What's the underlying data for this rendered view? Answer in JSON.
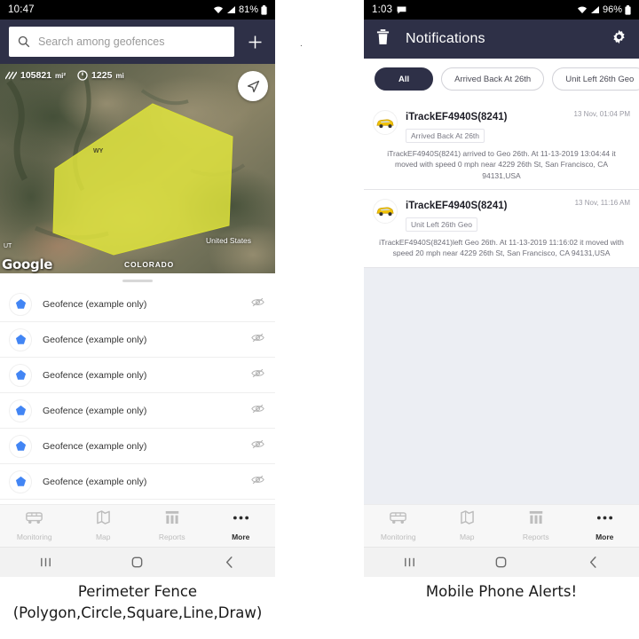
{
  "left_phone": {
    "status_bar": {
      "time": "10:47",
      "battery": "81%",
      "icons": [
        "wifi-icon",
        "signal-icon",
        "battery-icon"
      ]
    },
    "search": {
      "placeholder": "Search among geofences",
      "icon": "search-icon"
    },
    "add_button": {
      "label": "+",
      "icon": "plus-icon"
    },
    "map": {
      "area_value": "105821",
      "area_unit": "mi²",
      "perimeter_value": "1225",
      "perimeter_unit": "mi",
      "area_icon": "area-hatch-icon",
      "perimeter_icon": "perimeter-clock-icon",
      "locate_icon": "navigation-arrow-icon",
      "watermark": "Google",
      "labels": {
        "state": "COLORADO",
        "country": "United States",
        "wy": "WY",
        "ut": "UT"
      },
      "polygon_color": "#e3e83c"
    },
    "geofences": [
      {
        "name": "Geofence (example only)",
        "icon": "pentagon-icon",
        "visibility_icon": "eye-off-icon"
      },
      {
        "name": "Geofence (example only)",
        "icon": "pentagon-icon",
        "visibility_icon": "eye-off-icon"
      },
      {
        "name": "Geofence (example only)",
        "icon": "pentagon-icon",
        "visibility_icon": "eye-off-icon"
      },
      {
        "name": "Geofence (example only)",
        "icon": "pentagon-icon",
        "visibility_icon": "eye-off-icon"
      },
      {
        "name": "Geofence (example only)",
        "icon": "pentagon-icon",
        "visibility_icon": "eye-off-icon"
      },
      {
        "name": "Geofence (example only)",
        "icon": "pentagon-icon",
        "visibility_icon": "eye-off-icon"
      }
    ],
    "bottom_nav": [
      {
        "label": "Monitoring",
        "icon": "bus-icon",
        "active": false
      },
      {
        "label": "Map",
        "icon": "map-icon",
        "active": false
      },
      {
        "label": "Reports",
        "icon": "reports-icon",
        "active": false
      },
      {
        "label": "More",
        "icon": "more-dots-icon",
        "active": true
      }
    ]
  },
  "right_phone": {
    "status_bar": {
      "time": "1:03",
      "battery": "96%",
      "icons": [
        "message-icon",
        "wifi-icon",
        "signal-icon",
        "battery-icon"
      ]
    },
    "header": {
      "title": "Notifications",
      "delete_icon": "trash-icon",
      "settings_icon": "gear-icon"
    },
    "filters": [
      {
        "label": "All",
        "selected": true
      },
      {
        "label": "Arrived Back At 26th",
        "selected": false
      },
      {
        "label": "Unit Left 26th Geo",
        "selected": false
      }
    ],
    "notifications": [
      {
        "unit": "iTrackEF4940S(8241)",
        "tag": "Arrived Back At 26th",
        "time": "13 Nov, 01:04 PM",
        "body": "iTrackEF4940S(8241) arrived to Geo 26th.    At 11-13-2019 13:04:44 it moved with speed 0 mph near 4229 26th St, San Francisco, CA 94131,USA",
        "avatar_icon": "yellow-car-icon"
      },
      {
        "unit": "iTrackEF4940S(8241)",
        "tag": "Unit Left 26th Geo",
        "time": "13 Nov, 11:16 AM",
        "body": "iTrackEF4940S(8241)left Geo 26th.    At 11-13-2019 11:16:02 it moved with speed 20 mph near 4229 26th St, San Francisco, CA 94131,USA",
        "avatar_icon": "yellow-car-icon"
      }
    ],
    "bottom_nav": [
      {
        "label": "Monitoring",
        "icon": "bus-icon",
        "active": false
      },
      {
        "label": "Map",
        "icon": "map-icon",
        "active": false
      },
      {
        "label": "Reports",
        "icon": "reports-icon",
        "active": false
      },
      {
        "label": "More",
        "icon": "more-dots-icon",
        "active": true
      }
    ]
  },
  "captions": {
    "left_line1": "Perimeter Fence",
    "left_line2": "(Polygon,Circle,Square,Line,Draw)",
    "right_line1": "Mobile Phone Alerts!"
  },
  "theme": {
    "header_navy": "#2e3047",
    "accent_blue": "#4285f4",
    "polygon_yellow": "#e3e83c",
    "list_bg": "#eceef3"
  }
}
